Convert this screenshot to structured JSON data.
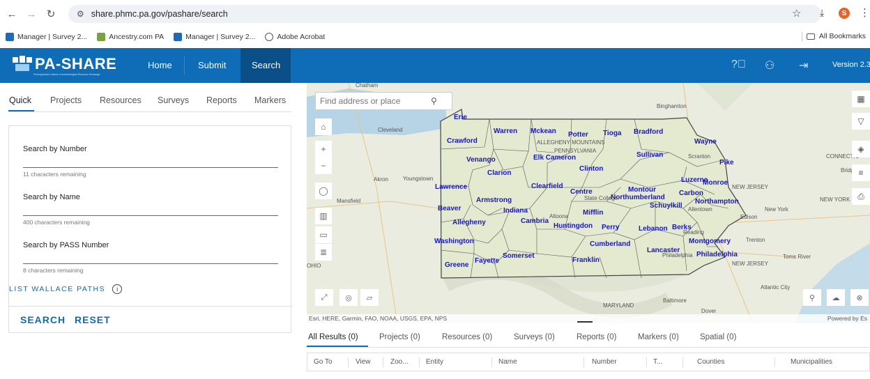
{
  "browser": {
    "url": "share.phmc.pa.gov/pashare/search",
    "bookmarks": [
      "Manager | Survey 2...",
      "Ancestry.com PA",
      "Manager | Survey 2...",
      "Adobe Acrobat"
    ],
    "all_bookmarks": "All Bookmarks",
    "profile_initial": "S"
  },
  "header": {
    "logo": "PA-SHARE",
    "logo_sub": "Pennsylvania's Historic & Archaeological Resource Exchange",
    "nav": [
      "Home",
      "Submit",
      "Search"
    ],
    "active_nav": "Search",
    "version": "Version 2.3.",
    "colors": {
      "brand": "#0f6cb6",
      "active": "#0b4f88"
    }
  },
  "search_tabs": [
    "Quick",
    "Projects",
    "Resources",
    "Surveys",
    "Reports",
    "Markers"
  ],
  "form": {
    "fields": [
      {
        "label": "Search by Number",
        "hint": "11 characters remaining"
      },
      {
        "label": "Search by Name",
        "hint": "400 characters remaining"
      },
      {
        "label": "Search by PASS Number",
        "hint": "8 characters remaining"
      }
    ],
    "wallace": "LIST WALLACE PATHS",
    "info": "i",
    "search_btn": "SEARCH",
    "reset_btn": "RESET"
  },
  "map": {
    "search_placeholder": "Find address or place",
    "attribution": "Esri, HERE, Garmin, FAO, NOAA, USGS, EPA, NPS",
    "powered": "Powered by Es",
    "counties": [
      "Erie",
      "Warren",
      "Mckean",
      "Potter",
      "Tioga",
      "Bradford",
      "Wayne",
      "Crawford",
      "Venango",
      "Elk",
      "Cameron",
      "Sullivan",
      "Pike",
      "Clarion",
      "Clinton",
      "Luzerne",
      "Monroe",
      "Lawrence",
      "Clearfield",
      "Centre",
      "Montour",
      "Carbon",
      "Armstrong",
      "Northumberland",
      "Beaver",
      "Indiana",
      "Mifflin",
      "Schuylkill",
      "Northampton",
      "Allegheny",
      "Cambria",
      "Huntingdon",
      "Perry",
      "Lebanon",
      "Berks",
      "Washington",
      "Cumberland",
      "Montgomery",
      "Lancaster",
      "Philadelphia",
      "Somerset",
      "Greene",
      "Fayette",
      "Franklin"
    ],
    "places": [
      "Chatham",
      "Binghamton",
      "Cleveland",
      "Youngstown",
      "Akron",
      "Mansfield",
      "NEW JERSEY",
      "New York",
      "Edison",
      "Trenton",
      "Toms River",
      "Atlantic City",
      "Baltimore",
      "MARYLAND",
      "Dover",
      "Bridgeport",
      "NEW YORK",
      "CONNECTIC",
      "ALLEGHENY MOUNTAINS",
      "PENNSYLVANIA",
      "OHIO",
      "Scranton",
      "Allentown",
      "Reading",
      "Altoona",
      "State College",
      "Philadelphia"
    ]
  },
  "results": {
    "tabs": [
      "All Results (0)",
      "Projects (0)",
      "Resources (0)",
      "Surveys (0)",
      "Reports (0)",
      "Markers (0)",
      "Spatial (0)"
    ],
    "columns": [
      "Go To",
      "View",
      "Zoo...",
      "Entity",
      "Name",
      "Number",
      "T...",
      "Counties",
      "Municipalities"
    ]
  }
}
